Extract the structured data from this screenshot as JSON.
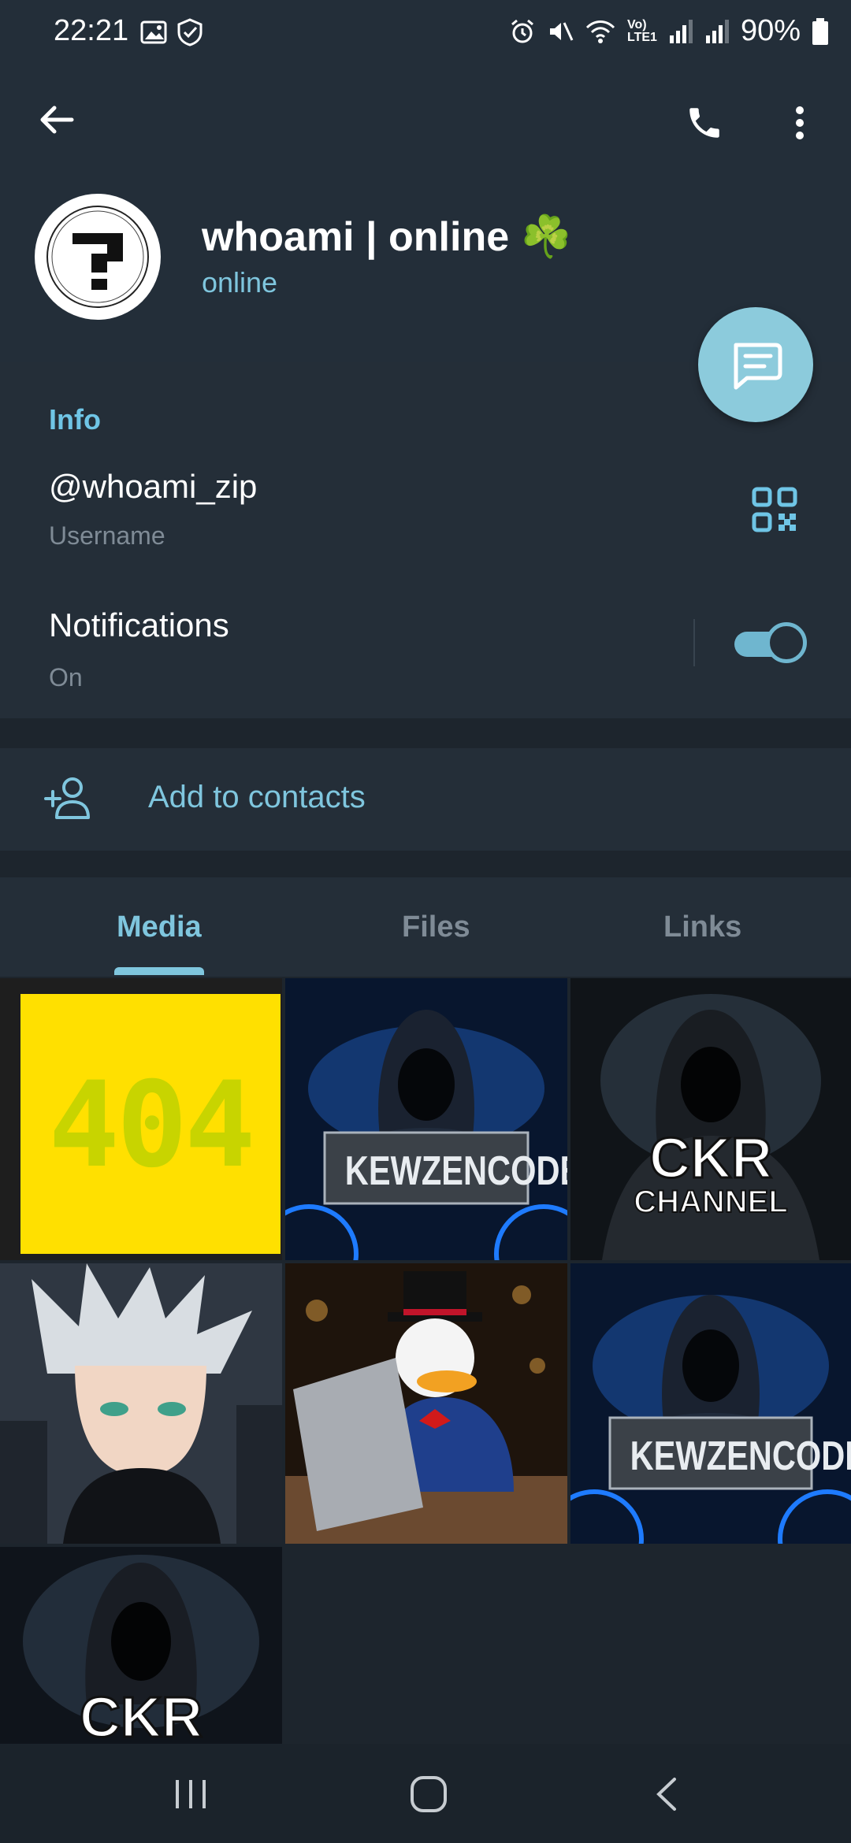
{
  "status_bar": {
    "time": "22:21",
    "battery": "90%"
  },
  "header": {
    "title": "whoami | online ☘️",
    "subtitle": "online"
  },
  "info": {
    "section_title": "Info",
    "username": "@whoami_zip",
    "username_label": "Username",
    "notifications_label": "Notifications",
    "notifications_state": "On",
    "notifications_enabled": true
  },
  "contacts": {
    "add_label": "Add to contacts"
  },
  "tabs": [
    {
      "label": "Media",
      "active": true
    },
    {
      "label": "Files",
      "active": false
    },
    {
      "label": "Links",
      "active": false
    }
  ],
  "media": [
    {
      "caption": "404"
    },
    {
      "caption": "KEWZENCODE"
    },
    {
      "caption": "CKR",
      "caption2": "CHANNEL"
    },
    {
      "caption": ""
    },
    {
      "caption": ""
    },
    {
      "caption": "KEWZENCODE"
    },
    {
      "caption": "CKR"
    }
  ],
  "icons": {
    "back": "arrow-left-icon",
    "call": "phone-icon",
    "more": "more-vertical-icon",
    "fab": "message-icon",
    "qr": "qr-code-icon",
    "add_contact": "add-user-icon"
  },
  "colors": {
    "accent": "#7fc6de",
    "header_bg": "#232e39",
    "section_bg": "#242e38",
    "page_bg": "#1d252d"
  }
}
